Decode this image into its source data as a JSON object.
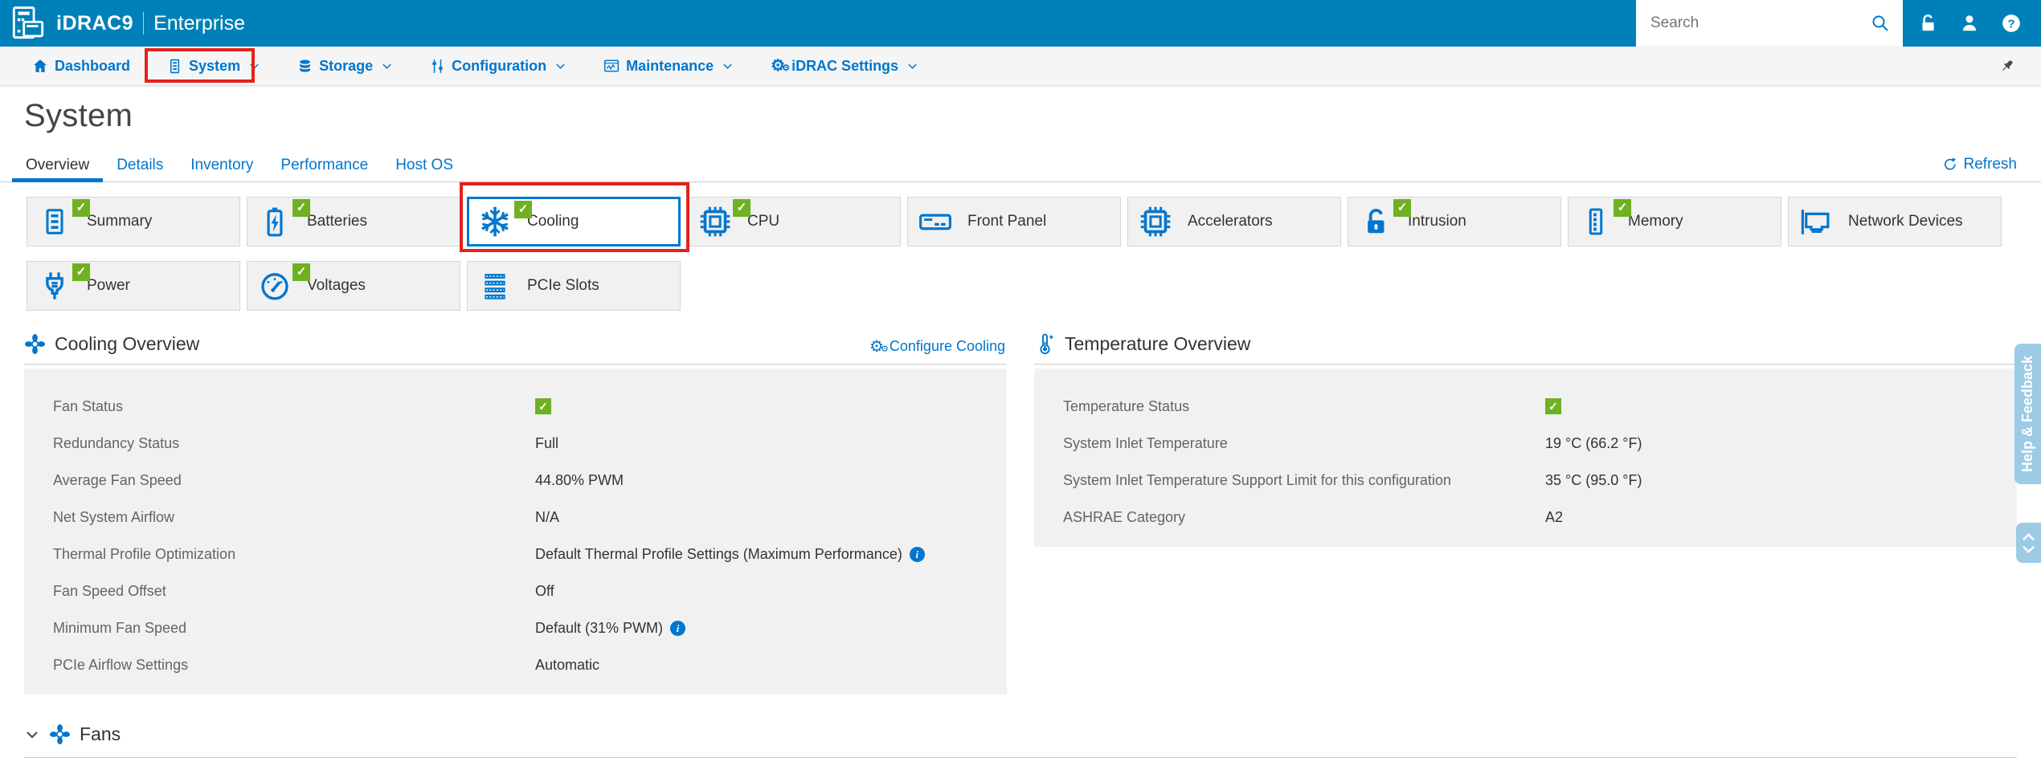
{
  "header": {
    "product": "iDRAC9",
    "edition": "Enterprise",
    "search_placeholder": "Search"
  },
  "nav": {
    "items": [
      {
        "label": "Dashboard",
        "icon": "home-icon",
        "dropdown": false
      },
      {
        "label": "System",
        "icon": "server-icon",
        "dropdown": true,
        "annotated": true
      },
      {
        "label": "Storage",
        "icon": "storage-icon",
        "dropdown": true
      },
      {
        "label": "Configuration",
        "icon": "sliders-icon",
        "dropdown": true
      },
      {
        "label": "Maintenance",
        "icon": "maintenance-icon",
        "dropdown": true
      },
      {
        "label": "iDRAC Settings",
        "icon": "gear-icon",
        "dropdown": true
      }
    ]
  },
  "page": {
    "title": "System",
    "tabs": [
      {
        "label": "Overview",
        "active": true
      },
      {
        "label": "Details",
        "active": false
      },
      {
        "label": "Inventory",
        "active": false
      },
      {
        "label": "Performance",
        "active": false
      },
      {
        "label": "Host OS",
        "active": false
      }
    ],
    "refresh_label": "Refresh"
  },
  "tiles": [
    {
      "label": "Summary",
      "icon": "server-icon",
      "checked": true,
      "selected": false
    },
    {
      "label": "Batteries",
      "icon": "battery-icon",
      "checked": true,
      "selected": false
    },
    {
      "label": "Cooling",
      "icon": "snowflake-icon",
      "checked": true,
      "selected": true
    },
    {
      "label": "CPU",
      "icon": "chip-icon",
      "checked": true,
      "selected": false
    },
    {
      "label": "Front Panel",
      "icon": "front-panel-icon",
      "checked": false,
      "selected": false
    },
    {
      "label": "Accelerators",
      "icon": "chip-icon",
      "checked": false,
      "selected": false
    },
    {
      "label": "Intrusion",
      "icon": "padlock-icon",
      "checked": true,
      "selected": false
    },
    {
      "label": "Memory",
      "icon": "memory-icon",
      "checked": true,
      "selected": false
    },
    {
      "label": "Network Devices",
      "icon": "network-card-icon",
      "checked": false,
      "selected": false
    },
    {
      "label": "Power",
      "icon": "plug-icon",
      "checked": true,
      "selected": false
    },
    {
      "label": "Voltages",
      "icon": "gauge-icon",
      "checked": true,
      "selected": false
    },
    {
      "label": "PCIe Slots",
      "icon": "pcie-slots-icon",
      "checked": false,
      "selected": false
    }
  ],
  "cooling_overview": {
    "title": "Cooling Overview",
    "configure_label": "Configure Cooling",
    "rows": [
      {
        "label": "Fan Status",
        "value": "",
        "status_ok": true
      },
      {
        "label": "Redundancy Status",
        "value": "Full"
      },
      {
        "label": "Average Fan Speed",
        "value": "44.80% PWM"
      },
      {
        "label": "Net System Airflow",
        "value": "N/A"
      },
      {
        "label": "Thermal Profile Optimization",
        "value": "Default Thermal Profile Settings (Maximum Performance)",
        "info": true
      },
      {
        "label": "Fan Speed Offset",
        "value": "Off"
      },
      {
        "label": "Minimum Fan Speed",
        "value": "Default (31% PWM)",
        "info": true
      },
      {
        "label": "PCIe Airflow Settings",
        "value": "Automatic"
      }
    ]
  },
  "temperature_overview": {
    "title": "Temperature Overview",
    "rows": [
      {
        "label": "Temperature Status",
        "value": "",
        "status_ok": true
      },
      {
        "label": "System Inlet Temperature",
        "value": "19 °C (66.2 °F)"
      },
      {
        "label": "System Inlet Temperature Support Limit for this configuration",
        "value": "35 °C (95.0 °F)"
      },
      {
        "label": "ASHRAE Category",
        "value": "A2"
      }
    ]
  },
  "fans_section": {
    "title": "Fans"
  },
  "help_tab": {
    "label": "Help & Feedback"
  },
  "colors": {
    "header_blue": "#0080b8",
    "accent_blue": "#0076ce",
    "success_green": "#6fb122",
    "annotation_red": "#e2231a",
    "panel_gray": "#f1f1f1",
    "help_tab_blue": "#9ccbe5"
  }
}
